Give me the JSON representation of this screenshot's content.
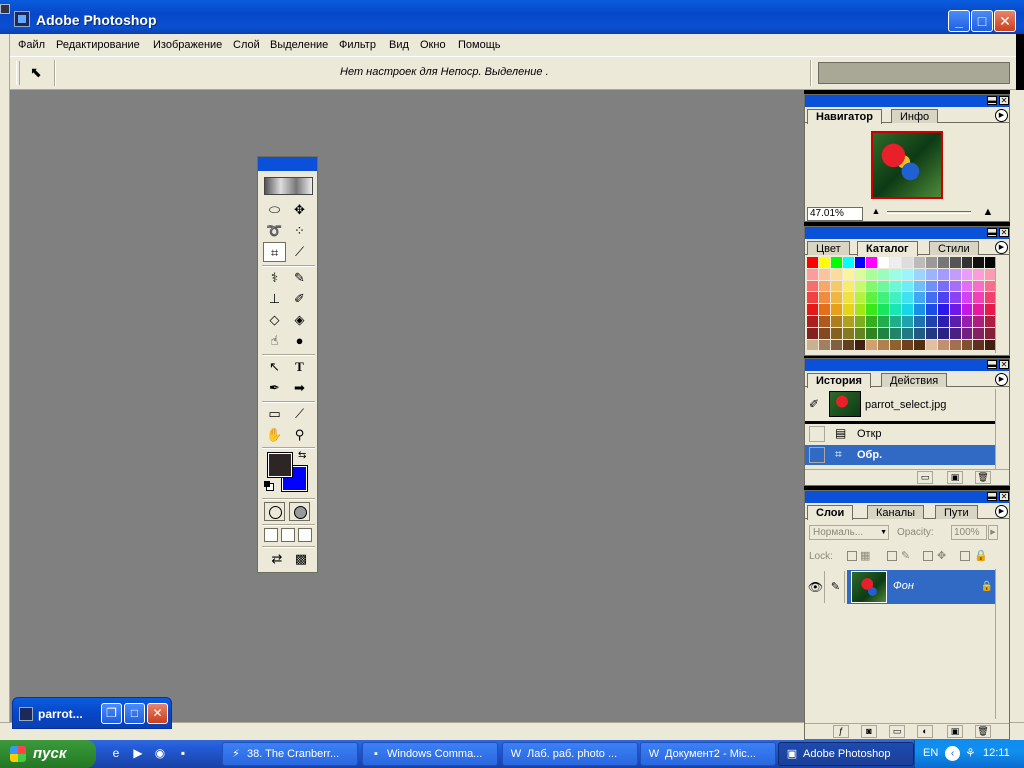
{
  "window": {
    "title": "Adobe Photoshop",
    "controls": {
      "minimize": "_",
      "maximize": "□",
      "close": "✕"
    }
  },
  "menu": [
    "Файл",
    "Редактирование",
    "Изображение",
    "Слой",
    "Выделение",
    "Фильтр",
    "Вид",
    "Окно",
    "Помощь"
  ],
  "options_bar": {
    "tool_icon": "move-arrow-icon",
    "message": "Нет настроек для  Непоср. Выделение   ."
  },
  "toolbox": {
    "foreground_color": "#2e2626",
    "background_color": "#0000ff"
  },
  "navigator": {
    "tabs": [
      "Навигатор",
      "Инфо"
    ],
    "zoom": "47.01%"
  },
  "swatches": {
    "tabs": [
      "Цвет",
      "Каталог",
      "Стили"
    ]
  },
  "history": {
    "tabs": [
      "История",
      "Действия"
    ],
    "snapshot": "parrot_select.jpg",
    "steps": [
      {
        "label": "Откр",
        "active": false
      },
      {
        "label": "Обр.",
        "active": true
      }
    ]
  },
  "layers": {
    "tabs": [
      "Слои",
      "Каналы",
      "Пути"
    ],
    "blend_mode": "Нормаль...",
    "opacity_label": "Opacity:",
    "opacity_value": "100%",
    "lock_label": "Lock:",
    "layer_name": "Фон"
  },
  "minimized_document": {
    "title": "parrot..."
  },
  "taskbar": {
    "start_label": "пуск",
    "tasks": [
      {
        "label": "38. The Cranberr...",
        "icon": "winamp-icon",
        "active": false
      },
      {
        "label": "Windows Comma...",
        "icon": "floppy-icon",
        "active": false
      },
      {
        "label": "Лаб. раб. photo ...",
        "icon": "word-icon",
        "active": false
      },
      {
        "label": "Документ2 - Mic...",
        "icon": "word-icon",
        "active": false
      },
      {
        "label": "Adobe Photoshop",
        "icon": "photoshop-icon",
        "active": true
      }
    ],
    "language": "EN",
    "clock": "12:11"
  },
  "colors": {
    "selection": "#316ac5",
    "xp_blue": "#0a50d8",
    "panel": "#ece9d8",
    "workspace": "#808080"
  }
}
